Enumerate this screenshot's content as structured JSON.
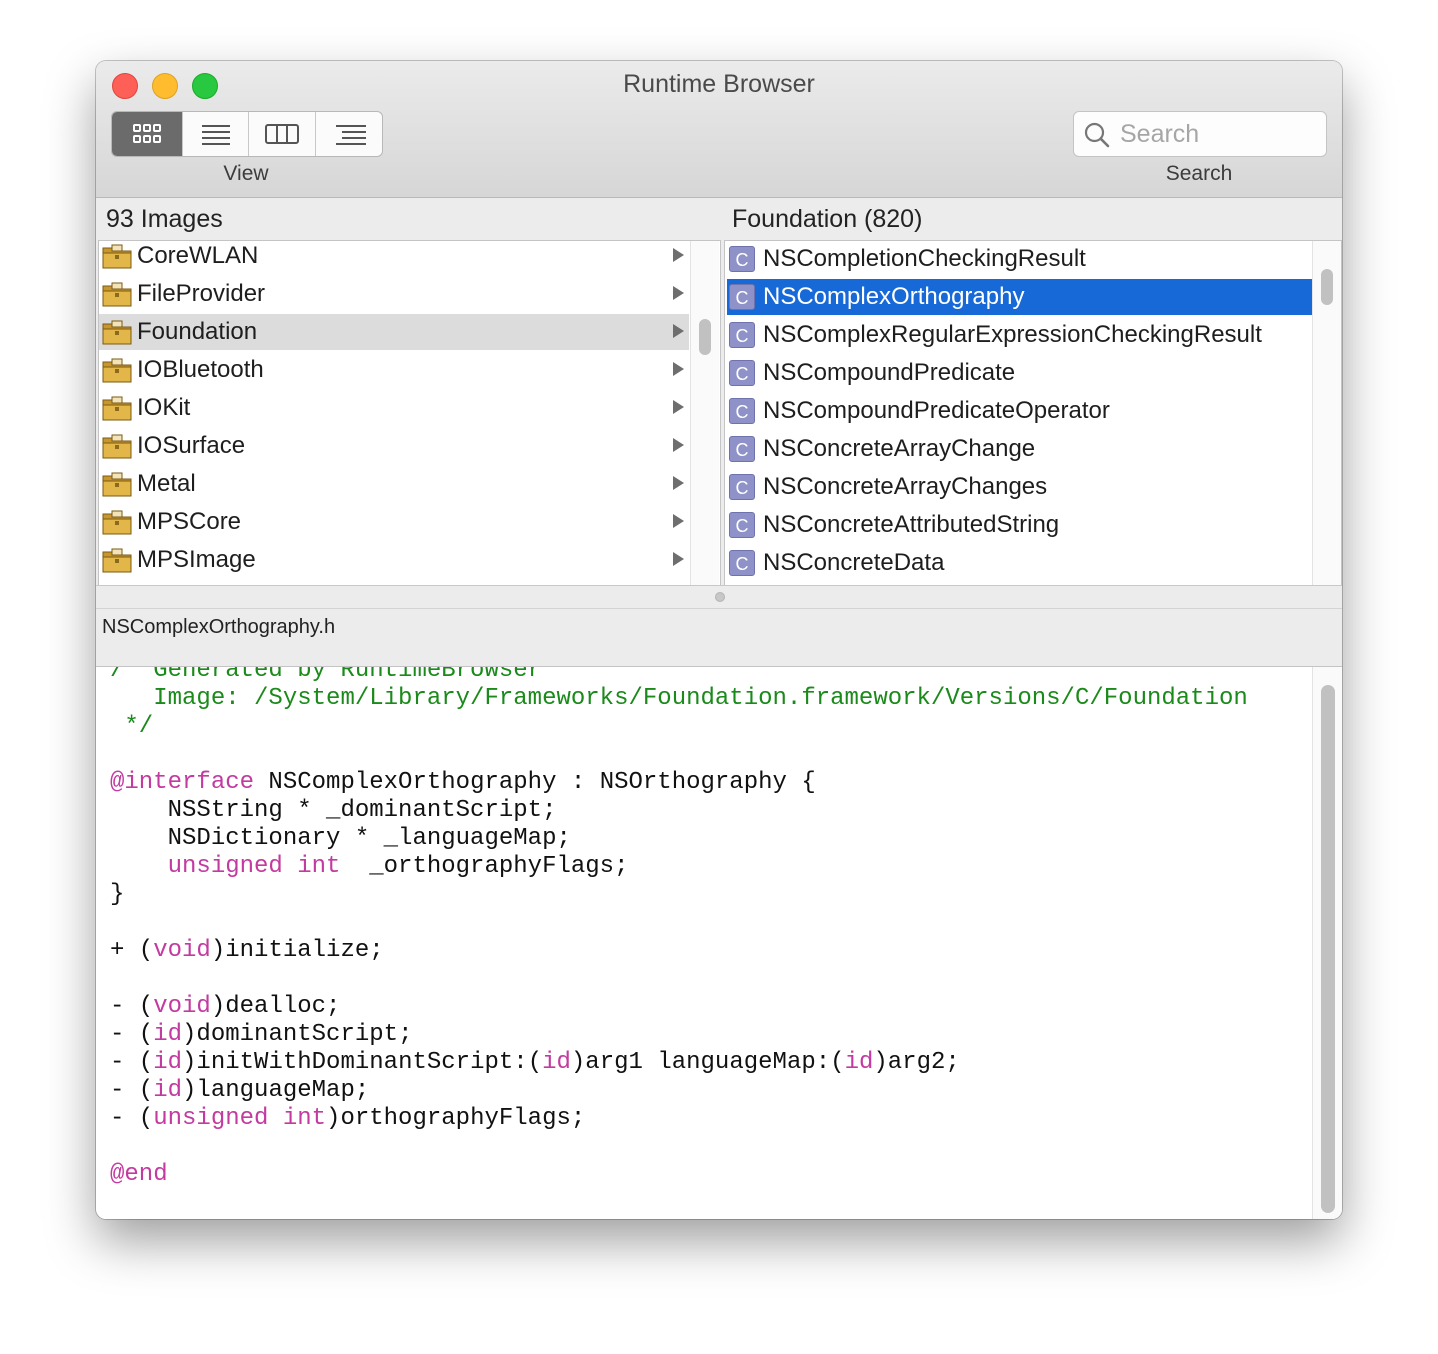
{
  "window": {
    "title": "Runtime Browser"
  },
  "toolbar": {
    "view_label": "View",
    "view_modes": [
      {
        "name": "icon-view",
        "icon": "grid-icon",
        "active": true
      },
      {
        "name": "list-view",
        "icon": "list-icon",
        "active": false
      },
      {
        "name": "column-view",
        "icon": "columns-icon",
        "active": false
      },
      {
        "name": "outline-view",
        "icon": "outline-icon",
        "active": false
      }
    ],
    "search_label": "Search",
    "search_placeholder": "Search",
    "search_value": ""
  },
  "images_pane": {
    "header": "93 Images",
    "selected_index": 2,
    "items": [
      {
        "label": "CoreWLAN"
      },
      {
        "label": "FileProvider"
      },
      {
        "label": "Foundation"
      },
      {
        "label": "IOBluetooth"
      },
      {
        "label": "IOKit"
      },
      {
        "label": "IOSurface"
      },
      {
        "label": "Metal"
      },
      {
        "label": "MPSCore"
      },
      {
        "label": "MPSImage"
      }
    ]
  },
  "classes_pane": {
    "header": "Foundation (820)",
    "selected_index": 1,
    "icon_glyph": "C",
    "items": [
      {
        "label": "NSCompletionCheckingResult"
      },
      {
        "label": "NSComplexOrthography"
      },
      {
        "label": "NSComplexRegularExpressionCheckingResult"
      },
      {
        "label": "NSCompoundPredicate"
      },
      {
        "label": "NSCompoundPredicateOperator"
      },
      {
        "label": "NSConcreteArrayChange"
      },
      {
        "label": "NSConcreteArrayChanges"
      },
      {
        "label": "NSConcreteAttributedString"
      },
      {
        "label": "NSConcreteData"
      }
    ]
  },
  "header_file": {
    "filename": "NSComplexOrthography.h",
    "lines": [
      [
        [
          "cm",
          "/* Generated by RuntimeBrowser"
        ]
      ],
      [
        [
          "cm",
          "   Image: /System/Library/Frameworks/Foundation.framework/Versions/C/Foundation"
        ]
      ],
      [
        [
          "cm",
          " */"
        ]
      ],
      [],
      [
        [
          "kw",
          "@interface"
        ],
        [
          "",
          " NSComplexOrthography : NSOrthography {"
        ]
      ],
      [
        [
          "",
          "    NSString * _dominantScript;"
        ]
      ],
      [
        [
          "",
          "    NSDictionary * _languageMap;"
        ]
      ],
      [
        [
          "kw",
          "    unsigned int"
        ],
        [
          "",
          "  _orthographyFlags;"
        ]
      ],
      [
        [
          "",
          "}"
        ]
      ],
      [],
      [
        [
          "",
          "+ ("
        ],
        [
          "kw",
          "void"
        ],
        [
          "",
          ")initialize;"
        ]
      ],
      [],
      [
        [
          "",
          "- ("
        ],
        [
          "kw",
          "void"
        ],
        [
          "",
          ")dealloc;"
        ]
      ],
      [
        [
          "",
          "- ("
        ],
        [
          "kw",
          "id"
        ],
        [
          "",
          ")dominantScript;"
        ]
      ],
      [
        [
          "",
          "- ("
        ],
        [
          "kw",
          "id"
        ],
        [
          "",
          ")initWithDominantScript:("
        ],
        [
          "kw",
          "id"
        ],
        [
          "",
          ")arg1 languageMap:("
        ],
        [
          "kw",
          "id"
        ],
        [
          "",
          ")arg2;"
        ]
      ],
      [
        [
          "",
          "- ("
        ],
        [
          "kw",
          "id"
        ],
        [
          "",
          ")languageMap;"
        ]
      ],
      [
        [
          "",
          "- ("
        ],
        [
          "kw",
          "unsigned int"
        ],
        [
          "",
          ")orthographyFlags;"
        ]
      ],
      [],
      [
        [
          "kw",
          "@end"
        ]
      ]
    ]
  },
  "colors": {
    "selection_blue": "#1869d8",
    "comment_green": "#1a8a1a",
    "keyword_magenta": "#c33aa0",
    "close": "#fe5f57",
    "minimize": "#febc2e",
    "maximize": "#28c840"
  }
}
